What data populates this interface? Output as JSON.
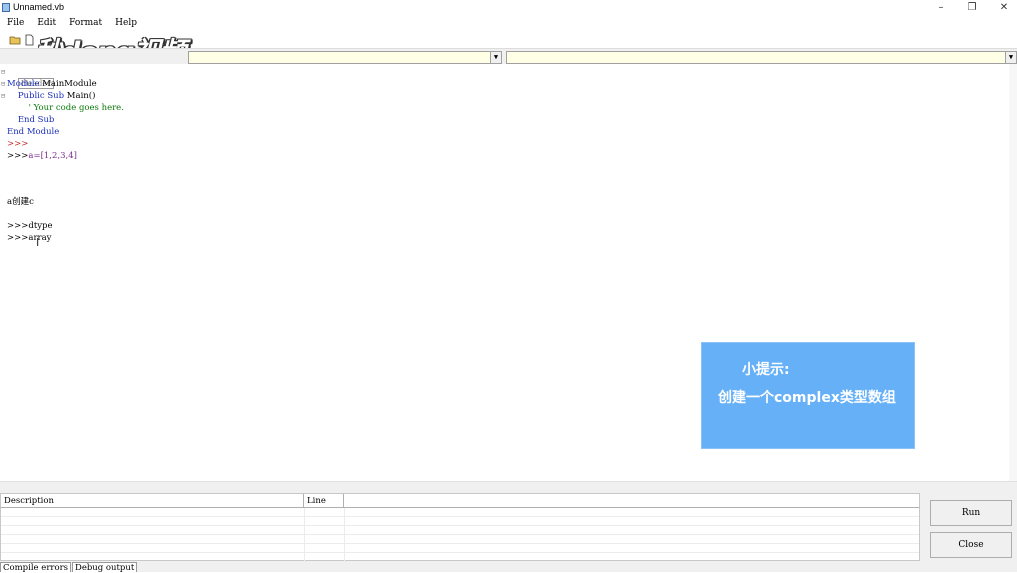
{
  "window": {
    "title": "Unnamed.vb",
    "controls": [
      "–",
      "❐",
      "✕"
    ]
  },
  "menu": [
    "File",
    "Edit",
    "Format",
    "Help"
  ],
  "watermark": "秒dong视频",
  "editor": {
    "header_label": "Header",
    "lines": [
      {
        "kw1": "Module",
        "rest": " MainModule"
      },
      {
        "indent": "    ",
        "kw1": "Public Sub",
        "rest": " Main()"
      },
      {
        "indent": "        ",
        "comment": "' Your code goes here."
      },
      {
        "indent": "    ",
        "kw1": "End Sub"
      },
      {
        "kw1": "End Module"
      }
    ],
    "prompt1": ">>>",
    "prompt2": ">>>",
    "array_code": "a=[1,2,3,4]",
    "text_create_c": "a创建c",
    "prompt3": ">>>",
    "dtype": "dtype",
    "prompt4": ">>>",
    "array": "array"
  },
  "tip": {
    "title": "小提示:",
    "body": "创建一个complex类型数组"
  },
  "errors_table": {
    "columns": [
      "Description",
      "Line"
    ]
  },
  "buttons": {
    "run": "Run",
    "close": "Close"
  },
  "tabs": [
    "Compile errors",
    "Debug output"
  ]
}
